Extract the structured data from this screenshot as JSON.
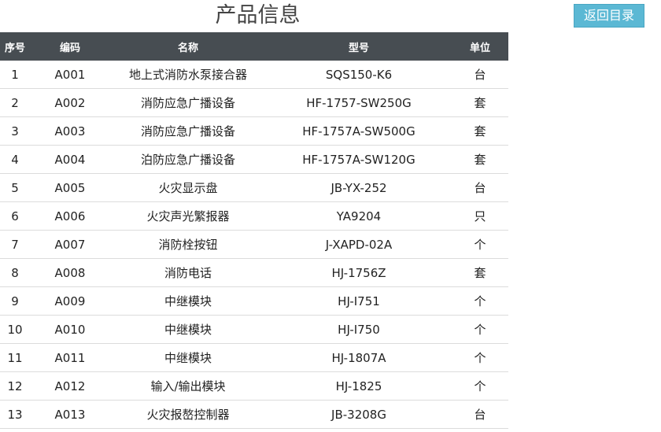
{
  "page": {
    "title": "产品信息",
    "back_label": "返回目录"
  },
  "table": {
    "headers": [
      "序号",
      "编码",
      "名称",
      "型号",
      "单位"
    ],
    "rows": [
      [
        "1",
        "A001",
        "地上式消防水泵接合器",
        "SQS150-K6",
        "台"
      ],
      [
        "2",
        "A002",
        "消防应急广播设备",
        "HF-1757-SW250G",
        "套"
      ],
      [
        "3",
        "A003",
        "消防应急广播设备",
        "HF-1757A-SW500G",
        "套"
      ],
      [
        "4",
        "A004",
        "泊防应急广播设备",
        "HF-1757A-SW120G",
        "套"
      ],
      [
        "5",
        "A005",
        "火灾显示盘",
        "JB-YX-252",
        "台"
      ],
      [
        "6",
        "A006",
        "火灾声光繁报器",
        "YA9204",
        "只"
      ],
      [
        "7",
        "A007",
        "消防栓按钮",
        "J-XAPD-02A",
        "个"
      ],
      [
        "8",
        "A008",
        "消防电话",
        "HJ-1756Z",
        "套"
      ],
      [
        "9",
        "A009",
        "中继模块",
        "HJ-I751",
        "个"
      ],
      [
        "10",
        "A010",
        "中继模块",
        "HJ-I750",
        "个"
      ],
      [
        "11",
        "A011",
        "中继模块",
        "HJ-1807A",
        "个"
      ],
      [
        "12",
        "A012",
        "输入/输出模块",
        "HJ-1825",
        "个"
      ],
      [
        "13",
        "A013",
        "火灾报嶅控制器",
        "JB-3208G",
        "台"
      ]
    ]
  },
  "colors": {
    "header_bg": "#474d52",
    "button_bg": "#5bb8d4"
  }
}
